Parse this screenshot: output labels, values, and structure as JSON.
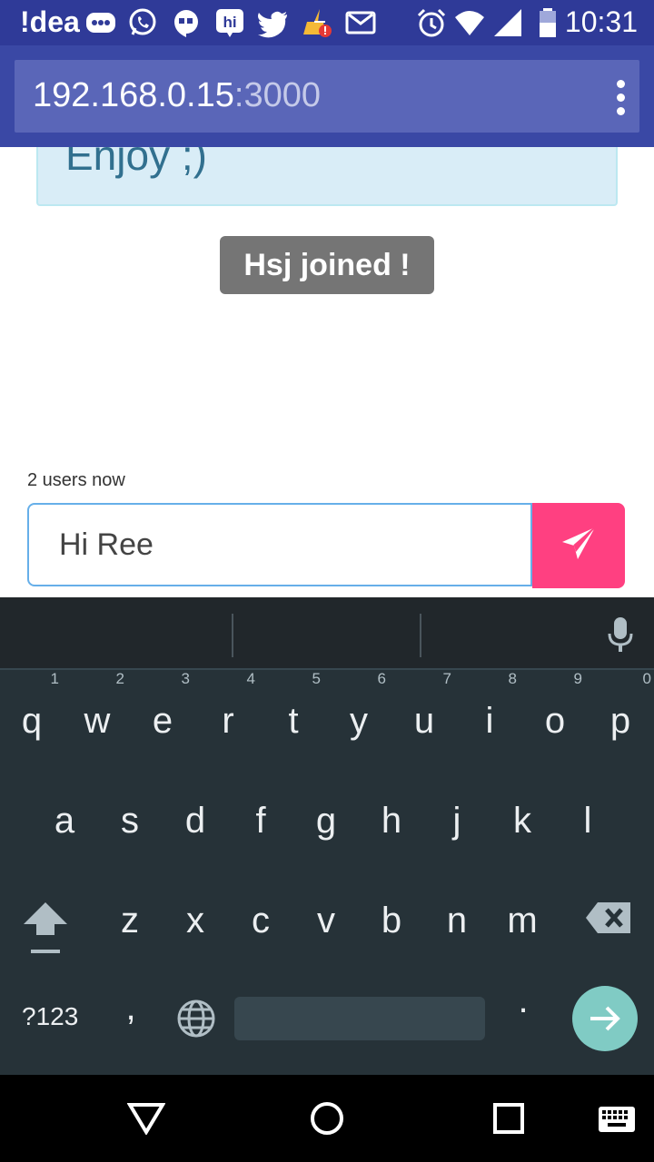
{
  "status_bar": {
    "carrier": "!dea",
    "time": "10:31",
    "icons": [
      "chat-dots-icon",
      "whatsapp-icon",
      "hangouts-icon",
      "hike-icon",
      "twitter-icon",
      "cleaner-alert-icon",
      "gmail-icon",
      "alarm-icon",
      "wifi-icon",
      "signal-icon",
      "battery-icon"
    ]
  },
  "browser": {
    "url_host": "192.168.0.15",
    "url_port": ":3000",
    "menu_icon": "overflow-menu-icon"
  },
  "chat": {
    "info_text": "Enjoy ;)",
    "join_toast": "Hsj joined !",
    "user_count": "2 users now",
    "message_value": "Hi Ree",
    "send_icon": "send-icon",
    "colors": {
      "send_button": "#ff4081",
      "toast": "#757575",
      "info_bg": "#d9edf7"
    }
  },
  "keyboard": {
    "row1": [
      {
        "key": "q",
        "hint": "1"
      },
      {
        "key": "w",
        "hint": "2"
      },
      {
        "key": "e",
        "hint": "3"
      },
      {
        "key": "r",
        "hint": "4"
      },
      {
        "key": "t",
        "hint": "5"
      },
      {
        "key": "y",
        "hint": "6"
      },
      {
        "key": "u",
        "hint": "7"
      },
      {
        "key": "i",
        "hint": "8"
      },
      {
        "key": "o",
        "hint": "9"
      },
      {
        "key": "p",
        "hint": "0"
      }
    ],
    "row2": [
      "a",
      "s",
      "d",
      "f",
      "g",
      "h",
      "j",
      "k",
      "l"
    ],
    "row3": [
      "z",
      "x",
      "c",
      "v",
      "b",
      "n",
      "m"
    ],
    "symbols_label": "?123",
    "comma": ",",
    "period": ".",
    "colors": {
      "background": "#263238",
      "enter": "#80cbc4"
    }
  },
  "nav": {
    "icons": [
      "back-icon",
      "home-icon",
      "recents-icon",
      "keyboard-switch-icon"
    ]
  }
}
